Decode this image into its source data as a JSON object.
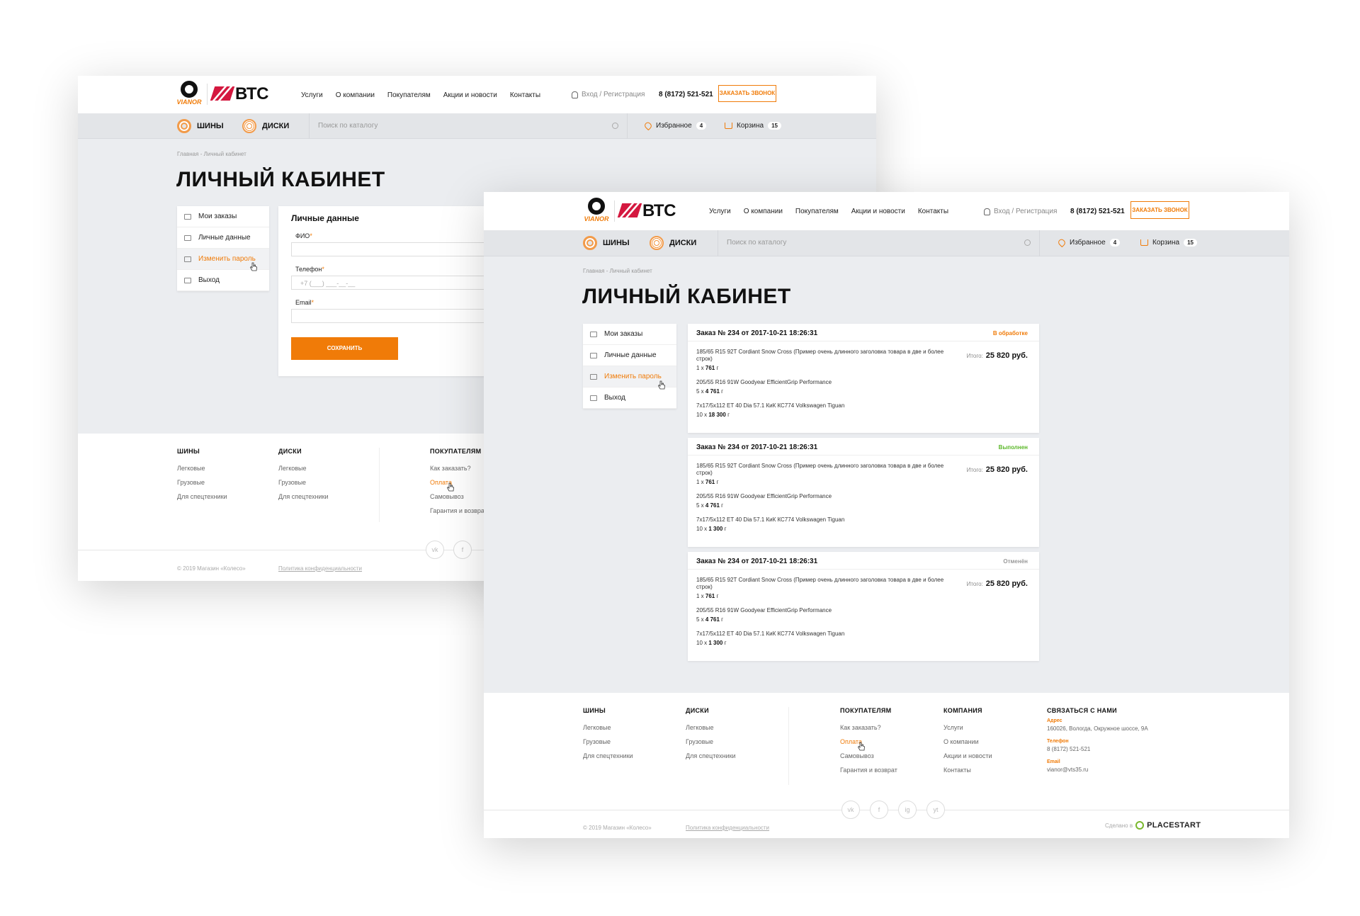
{
  "brand": {
    "vianor": "VIANOR",
    "vts": "ВТС"
  },
  "nav": {
    "items": [
      "Услуги",
      "О компании",
      "Покупателям",
      "Акции и новости",
      "Контакты"
    ],
    "login": "Вход / Регистрация",
    "phone": "8 (8172) 521-521",
    "callback": "ЗАКАЗАТЬ ЗВОНОК"
  },
  "catbar": {
    "tires": "ШИНЫ",
    "rims": "ДИСКИ",
    "search_placeholder": "Поиск по каталогу",
    "favorites": "Избранное",
    "favorites_count": "4",
    "cart": "Корзина",
    "cart_count": "15"
  },
  "breadcrumb": {
    "home": "Главная",
    "sep": "-",
    "current": "Личный кабинет"
  },
  "page_title": "ЛИЧНЫЙ КАБИНЕТ",
  "sidebar": {
    "items": [
      {
        "label": "Мои заказы",
        "icon": "orders-icon"
      },
      {
        "label": "Личные данные",
        "icon": "id-card-icon"
      },
      {
        "label": "Изменить пароль",
        "icon": "lock-icon",
        "active": true
      },
      {
        "label": "Выход",
        "icon": "logout-icon"
      }
    ]
  },
  "personal": {
    "title": "Личные данные",
    "fio_label": "ФИО",
    "phone_label": "Телефон",
    "phone_placeholder": "+7 (___) ___-__-__",
    "email_label": "Email",
    "required_mark": "*",
    "save": "СОХРАНИТЬ"
  },
  "orders": [
    {
      "title": "Заказ № 234 от 2017-10-21 18:26:31",
      "status": "В обработке",
      "status_color": "#f07b08",
      "total_label": "Итого:",
      "total": "25 820 руб.",
      "items": [
        {
          "name": "185/65 R15 92T Cordiant Snow Cross (Пример очень длинного заголовка товара в две и более строк)",
          "qty": "1 x",
          "price": "761",
          "unit": "г"
        },
        {
          "name": "205/55 R16 91W Goodyear EfficientGrip Performance",
          "qty": "5 x",
          "price": "4 761",
          "unit": "г"
        },
        {
          "name": "7x17/5x112 ET 40 Dia 57.1 КиК КС774 Volkswagen Tiguan",
          "qty": "10 x",
          "price": "18 300",
          "unit": "г"
        }
      ]
    },
    {
      "title": "Заказ № 234 от 2017-10-21 18:26:31",
      "status": "Выполнен",
      "status_color": "#5cb82a",
      "total_label": "Итого:",
      "total": "25 820 руб.",
      "items": [
        {
          "name": "185/65 R15 92T Cordiant Snow Cross (Пример очень длинного заголовка товара в две и более строк)",
          "qty": "1 x",
          "price": "761",
          "unit": "г"
        },
        {
          "name": "205/55 R16 91W Goodyear EfficientGrip Performance",
          "qty": "5 x",
          "price": "4 761",
          "unit": "г"
        },
        {
          "name": "7x17/5x112 ET 40 Dia 57.1 КиК КС774 Volkswagen Tiguan",
          "qty": "10 x",
          "price": "1 300",
          "unit": "г"
        }
      ]
    },
    {
      "title": "Заказ № 234 от 2017-10-21 18:26:31",
      "status": "Отменён",
      "status_color": "#999999",
      "total_label": "Итого:",
      "total": "25 820 руб.",
      "items": [
        {
          "name": "185/65 R15 92T Cordiant Snow Cross (Пример очень длинного заголовка товара в две и более строк)",
          "qty": "1 x",
          "price": "761",
          "unit": "г"
        },
        {
          "name": "205/55 R16 91W Goodyear EfficientGrip Performance",
          "qty": "5 x",
          "price": "4 761",
          "unit": "г"
        },
        {
          "name": "7x17/5x112 ET 40 Dia 57.1 КиК КС774 Volkswagen Tiguan",
          "qty": "10 x",
          "price": "1 300",
          "unit": "г"
        }
      ]
    }
  ],
  "footer": {
    "tires": {
      "title": "ШИНЫ",
      "links": [
        "Легковые",
        "Грузовые",
        "Для спецтехники"
      ]
    },
    "rims": {
      "title": "ДИСКИ",
      "links": [
        "Легковые",
        "Грузовые",
        "Для спецтехники"
      ]
    },
    "buyers": {
      "title": "ПОКУПАТЕЛЯМ",
      "links": [
        "Как заказать?",
        "Оплата",
        "Самовывоз",
        "Гарантия и возврат"
      ]
    },
    "company": {
      "title": "КОМПАНИЯ",
      "links": [
        "Услуги",
        "О компании",
        "Акции и новости",
        "Контакты"
      ]
    },
    "contact": {
      "title": "СВЯЗАТЬСЯ С НАМИ",
      "address_label": "Адрес",
      "address": "160026, Вологда, Окружное шоссе, 9А",
      "phone_label": "Телефон",
      "phone": "8 (8172) 521-521",
      "email_label": "Email",
      "email": "vianor@vts35.ru"
    },
    "copyright": "© 2019 Магазин «Колесо»",
    "policy": "Политика конфиденциальности",
    "made_by": "Сделано в",
    "made_brand": "PLACESTART",
    "social": [
      "vk",
      "f",
      "ig",
      "yt"
    ]
  },
  "colors": {
    "accent": "#f07b08",
    "brand_red": "#d4183f"
  }
}
